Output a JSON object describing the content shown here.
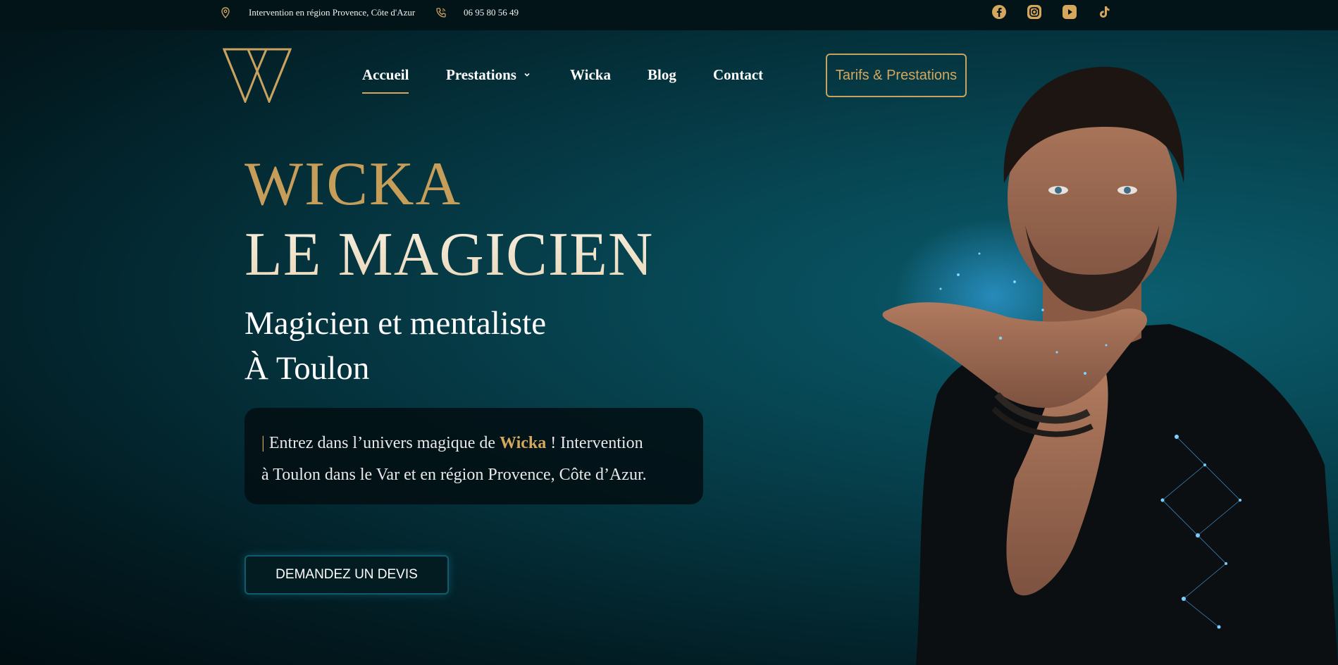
{
  "topbar": {
    "location_text": "Intervention en région Provence, Côte d'Azur",
    "phone_text": "06 95 80 56 49",
    "socials": [
      "facebook-icon",
      "instagram-icon",
      "youtube-icon",
      "tiktok-icon"
    ]
  },
  "nav": {
    "items": [
      {
        "label": "Accueil",
        "active": true
      },
      {
        "label": "Prestations",
        "has_dropdown": true
      },
      {
        "label": "Wicka"
      },
      {
        "label": "Blog"
      },
      {
        "label": "Contact"
      }
    ],
    "cta": "Tarifs & Prestations"
  },
  "hero": {
    "title_line1": "WICKA",
    "title_line2": "LE MAGICIEN",
    "subtitle_line1": "Magicien et mentaliste",
    "subtitle_line2": "À Toulon",
    "intro_bar": "|",
    "intro_before": "Entrez dans l’univers magique de",
    "intro_brand": "Wicka",
    "intro_after": "! Intervention",
    "intro_line2": "à Toulon dans le Var et en région Provence, Côte d’Azur.",
    "button": "DEMANDEZ UN DEVIS"
  },
  "colors": {
    "gold": "#d4a75c",
    "dark": "#031418",
    "teal": "#074653"
  }
}
